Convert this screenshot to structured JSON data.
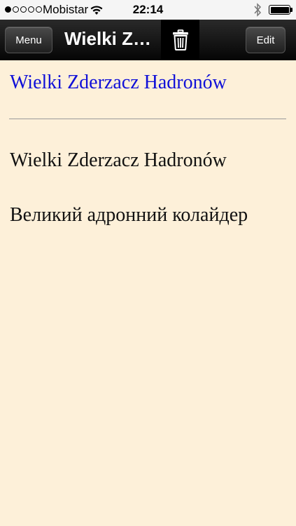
{
  "status_bar": {
    "carrier": "Mobistar",
    "time": "22:14",
    "signal_bars_filled": 1,
    "signal_bars_total": 5,
    "battery_level": 1.0
  },
  "nav": {
    "menu_label": "Menu",
    "title": "Wielki Zderzacz Hadronów",
    "edit_label": "Edit"
  },
  "entry": {
    "heading": "Wielki Zderzacz Hadronów",
    "term": "Wielki Zderzacz Hadronów",
    "translation": "Великий адронний колайдер"
  },
  "colors": {
    "background": "#fdf0d9",
    "link": "#1010d8"
  },
  "icons": [
    "wifi-icon",
    "bluetooth-icon",
    "battery-icon",
    "trash-icon"
  ]
}
